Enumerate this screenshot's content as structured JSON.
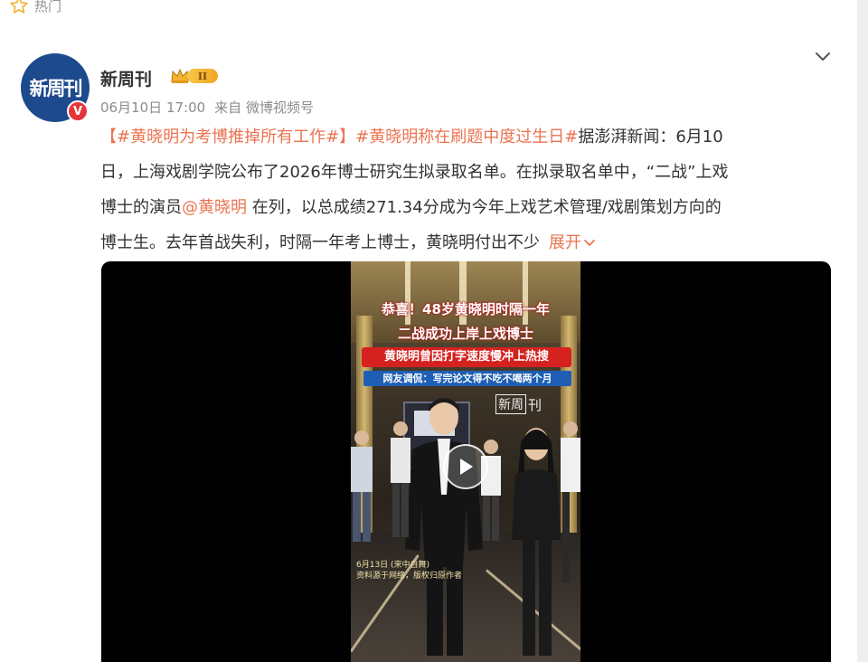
{
  "feed": {
    "hot_label": "热门"
  },
  "account": {
    "avatar_text": "新周刊",
    "name": "新周刊",
    "verified_mark": "V",
    "level": "II",
    "time": "06月10日 17:00",
    "source": "来自 微博视频号"
  },
  "post": {
    "line1": {
      "bracket_open": "【",
      "tag1": "#黄晓明为考博推掉所有工作#",
      "bracket_close": "】",
      "tag2": "#黄晓明称在刷题中度过生日#",
      "rest": "据澎湃新闻：6月10"
    },
    "line2": "日，上海戏剧学院公布了2026年博士研究生拟录取名单。在拟录取名单中，“二战”上戏",
    "line3": {
      "before": "博士的演员",
      "mention": "@黄晓明",
      "after": " 在列，以总成绩271.34分成为今年上戏艺术管理/戏剧策划方向的"
    },
    "line4": "博士生。去年首战失利，时隔一年考上博士，黄晓明付出不少",
    "expand_label": "展开"
  },
  "video": {
    "caption_1": "恭喜！48岁黄晓明时隔一年",
    "caption_2": "二战成功上岸上戏博士",
    "caption_3": "黄晓明曾因打字速度慢冲上热搜",
    "caption_4": "网友调侃：写完论文得不吃不喝两个月",
    "watermark_box": "新周",
    "watermark_text": "刊",
    "subtitle_1": "6月13日 (来中自舞)",
    "subtitle_2": "资料源于网络，版权归原作者"
  },
  "colors": {
    "accent": "#eb7350",
    "text": "#333333",
    "meta": "#8c8c8c",
    "avatar_bg": "#1d4a8d",
    "verified": "#e5353a"
  }
}
